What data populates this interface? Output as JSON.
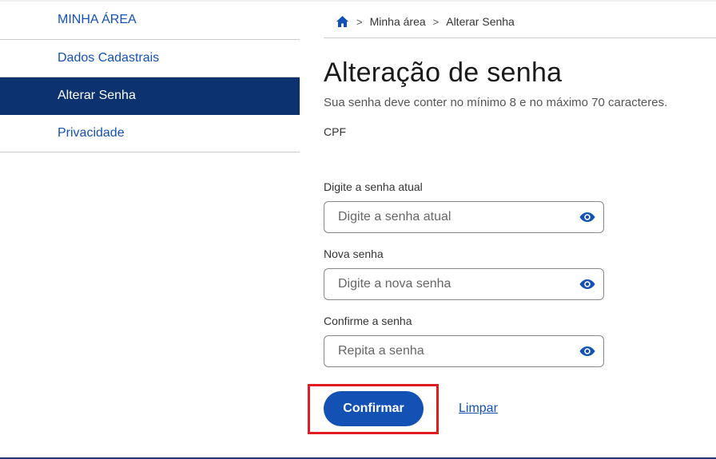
{
  "sidebar": {
    "heading": "MINHA ÁREA",
    "items": [
      {
        "label": "Dados Cadastrais",
        "active": false
      },
      {
        "label": "Alterar Senha",
        "active": true
      },
      {
        "label": "Privacidade",
        "active": false
      }
    ]
  },
  "breadcrumb": {
    "home_icon": "home-icon",
    "separator": ">",
    "items": [
      "Minha área",
      "Alterar Senha"
    ]
  },
  "main": {
    "title": "Alteração de senha",
    "subtitle": "Sua senha deve conter no mínimo 8 e no máximo 70 caracteres.",
    "cpf_label": "CPF",
    "fields": [
      {
        "label": "Digite a senha atual",
        "placeholder": "Digite a senha atual",
        "value": "",
        "icon": "eye-icon"
      },
      {
        "label": "Nova senha",
        "placeholder": "Digite a nova senha",
        "value": "",
        "icon": "eye-icon"
      },
      {
        "label": "Confirme a senha",
        "placeholder": "Repita a senha",
        "value": "",
        "icon": "eye-icon"
      }
    ]
  },
  "actions": {
    "confirm_label": "Confirmar",
    "clear_label": "Limpar"
  },
  "colors": {
    "primary": "#1351b4",
    "sidebar_active_bg": "#0c326f",
    "highlight": "#e11b22"
  }
}
